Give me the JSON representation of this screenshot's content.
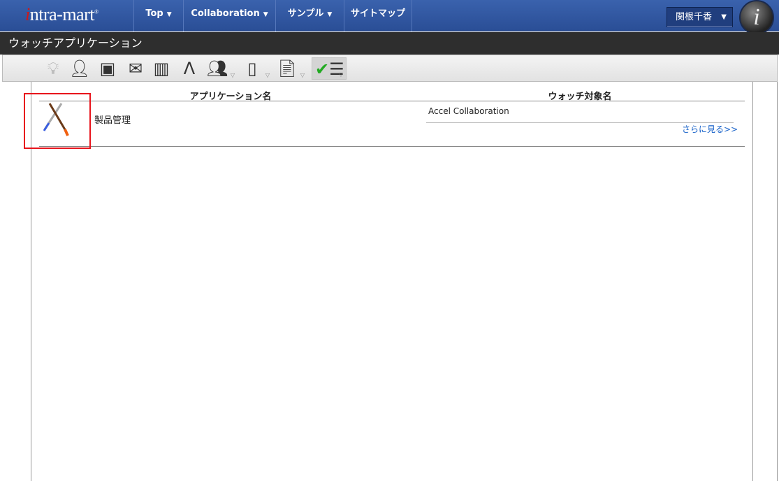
{
  "header": {
    "logo_text": "intra-mart",
    "nav": [
      {
        "label": "Top"
      },
      {
        "label": "Collaboration"
      },
      {
        "label": "サンプル"
      },
      {
        "label": "サイトマップ"
      }
    ],
    "user_name": "関根千香"
  },
  "page_title": "ウォッチアプリケーション",
  "toolbar": [
    "lightbulb-icon",
    "person-icon",
    "box-icon",
    "mail-icon",
    "building-icon",
    "compass-icon",
    "group-icon",
    "clipboard-person-icon",
    "document-pin-icon",
    "checklist-icon"
  ],
  "table": {
    "columns": [
      "アプリケーション名",
      "ウォッチ対象名"
    ],
    "rows": [
      {
        "app_name": "製品管理",
        "watch_targets": [
          "Accel Collaboration"
        ],
        "more_link": "さらに見る>>"
      }
    ]
  }
}
